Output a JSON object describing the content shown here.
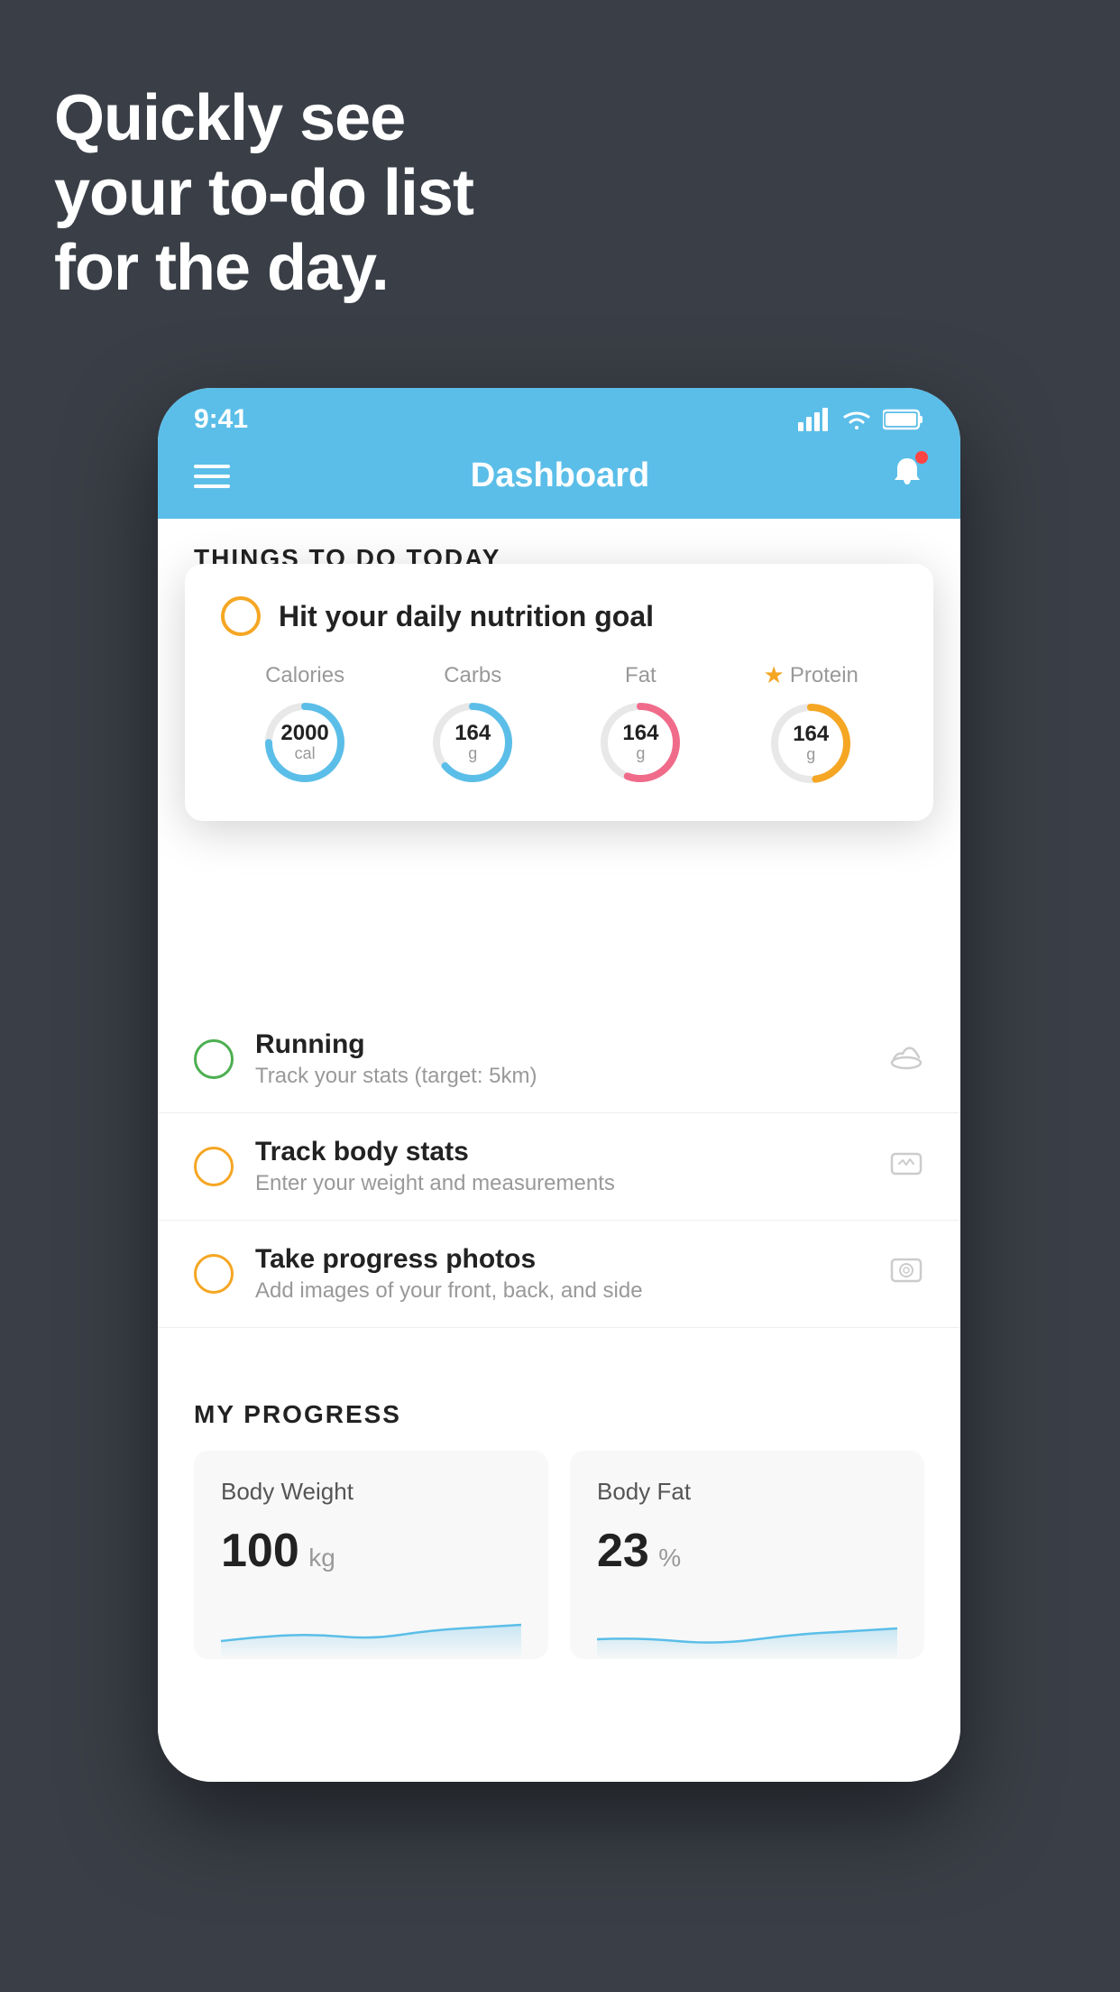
{
  "hero": {
    "line1": "Quickly see",
    "line2": "your to-do list",
    "line3": "for the day."
  },
  "phone": {
    "statusBar": {
      "time": "9:41",
      "signal": "▋▋▋▋",
      "wifi": "WiFi",
      "battery": "Battery"
    },
    "header": {
      "title": "Dashboard"
    },
    "thingsSection": {
      "label": "THINGS TO DO TODAY"
    },
    "nutritionCard": {
      "title": "Hit your daily nutrition goal",
      "stats": [
        {
          "label": "Calories",
          "value": "2000",
          "unit": "cal",
          "color": "#5bbee8",
          "starred": false
        },
        {
          "label": "Carbs",
          "value": "164",
          "unit": "g",
          "color": "#5bbee8",
          "starred": false
        },
        {
          "label": "Fat",
          "value": "164",
          "unit": "g",
          "color": "#f06b8a",
          "starred": false
        },
        {
          "label": "Protein",
          "value": "164",
          "unit": "g",
          "color": "#f5a623",
          "starred": true
        }
      ]
    },
    "todoItems": [
      {
        "title": "Running",
        "sub": "Track your stats (target: 5km)",
        "circleColor": "green",
        "icon": "👟"
      },
      {
        "title": "Track body stats",
        "sub": "Enter your weight and measurements",
        "circleColor": "yellow",
        "icon": "⚖️"
      },
      {
        "title": "Take progress photos",
        "sub": "Add images of your front, back, and side",
        "circleColor": "yellow",
        "icon": "🪪"
      }
    ],
    "progress": {
      "sectionLabel": "MY PROGRESS",
      "cards": [
        {
          "title": "Body Weight",
          "value": "100",
          "unit": "kg"
        },
        {
          "title": "Body Fat",
          "value": "23",
          "unit": "%"
        }
      ]
    }
  }
}
